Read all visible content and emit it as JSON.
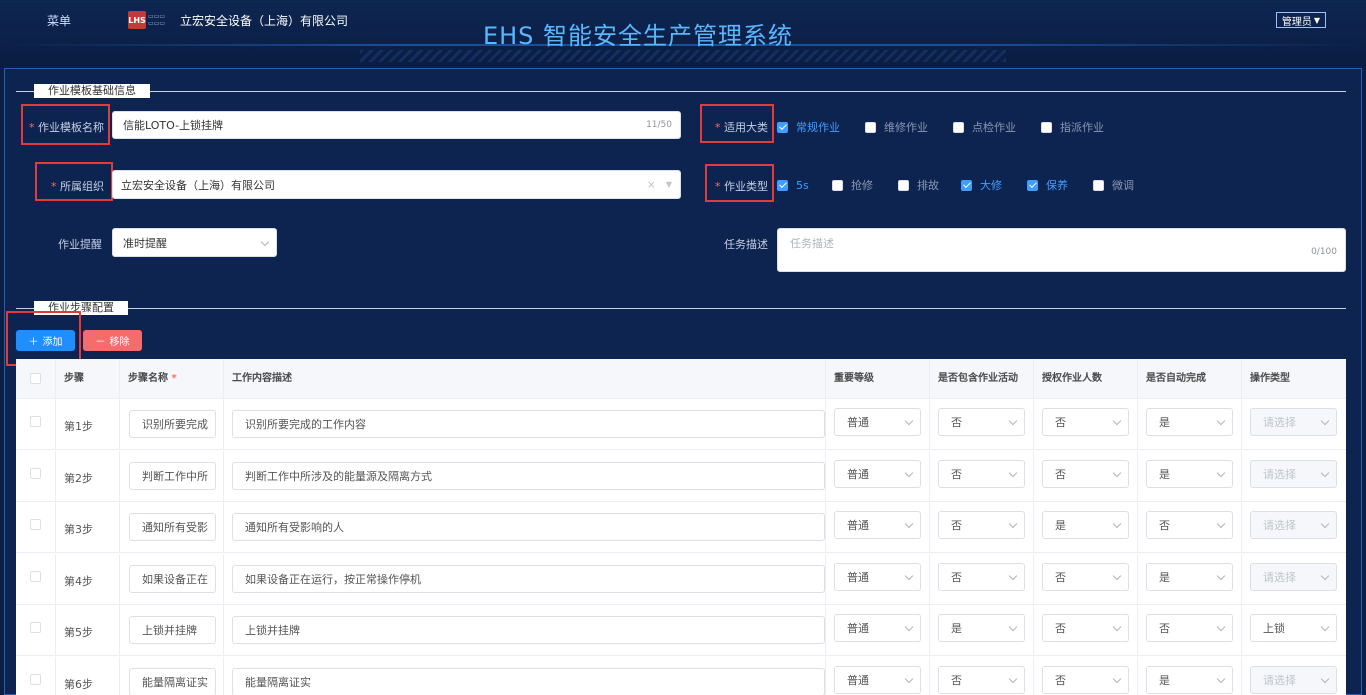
{
  "header": {
    "menu_label": "菜单",
    "company_name": "立宏安全设备（上海）有限公司",
    "logo_text": "LHS",
    "system_title": "EHS 智能安全生产管理系统",
    "admin_label": "管理员"
  },
  "basic_section": {
    "title": "作业模板基础信息",
    "template_name": {
      "label": "作业模板名称",
      "value": "信能LOTO-上锁挂牌",
      "counter": "11/50"
    },
    "organization": {
      "label": "所属组织",
      "value": "立宏安全设备（上海）有限公司"
    },
    "reminder": {
      "label": "作业提醒",
      "value": "准时提醒"
    },
    "category": {
      "label": "适用大类",
      "options": [
        {
          "label": "常规作业",
          "checked": true
        },
        {
          "label": "维修作业",
          "checked": false
        },
        {
          "label": "点检作业",
          "checked": false
        },
        {
          "label": "指派作业",
          "checked": false
        }
      ]
    },
    "job_type": {
      "label": "作业类型",
      "options": [
        {
          "label": "5s",
          "checked": true
        },
        {
          "label": "抢修",
          "checked": false
        },
        {
          "label": "排故",
          "checked": false
        },
        {
          "label": "大修",
          "checked": true
        },
        {
          "label": "保养",
          "checked": true
        },
        {
          "label": "微调",
          "checked": false
        }
      ]
    },
    "description": {
      "label": "任务描述",
      "placeholder": "任务描述",
      "counter": "0/100"
    }
  },
  "steps_section": {
    "title": "作业步骤配置",
    "add_label": "添加",
    "remove_label": "移除"
  },
  "table": {
    "headers": [
      "步骤",
      "步骤名称",
      "工作内容描述",
      "重要等级",
      "是否包含作业活动",
      "授权作业人数",
      "是否自动完成",
      "操作类型"
    ],
    "rows": [
      {
        "step": "第1步",
        "name": "识别所要完成",
        "desc": "识别所要完成的工作内容",
        "level": "普通",
        "activity": "否",
        "auth": "否",
        "auto": "是",
        "op": "请选择"
      },
      {
        "step": "第2步",
        "name": "判断工作中所",
        "desc": "判断工作中所涉及的能量源及隔离方式",
        "level": "普通",
        "activity": "否",
        "auth": "否",
        "auto": "是",
        "op": "请选择"
      },
      {
        "step": "第3步",
        "name": "通知所有受影",
        "desc": "通知所有受影响的人",
        "level": "普通",
        "activity": "否",
        "auth": "是",
        "auto": "否",
        "op": "请选择"
      },
      {
        "step": "第4步",
        "name": "如果设备正在",
        "desc": "如果设备正在运行，按正常操作停机",
        "level": "普通",
        "activity": "否",
        "auth": "否",
        "auto": "是",
        "op": "请选择"
      },
      {
        "step": "第5步",
        "name": "上锁并挂牌",
        "desc": "上锁并挂牌",
        "level": "普通",
        "activity": "是",
        "auth": "否",
        "auto": "否",
        "op": "上锁"
      },
      {
        "step": "第6步",
        "name": "能量隔离证实",
        "desc": "能量隔离证实",
        "level": "普通",
        "activity": "否",
        "auth": "否",
        "auto": "是",
        "op": "请选择"
      }
    ]
  }
}
